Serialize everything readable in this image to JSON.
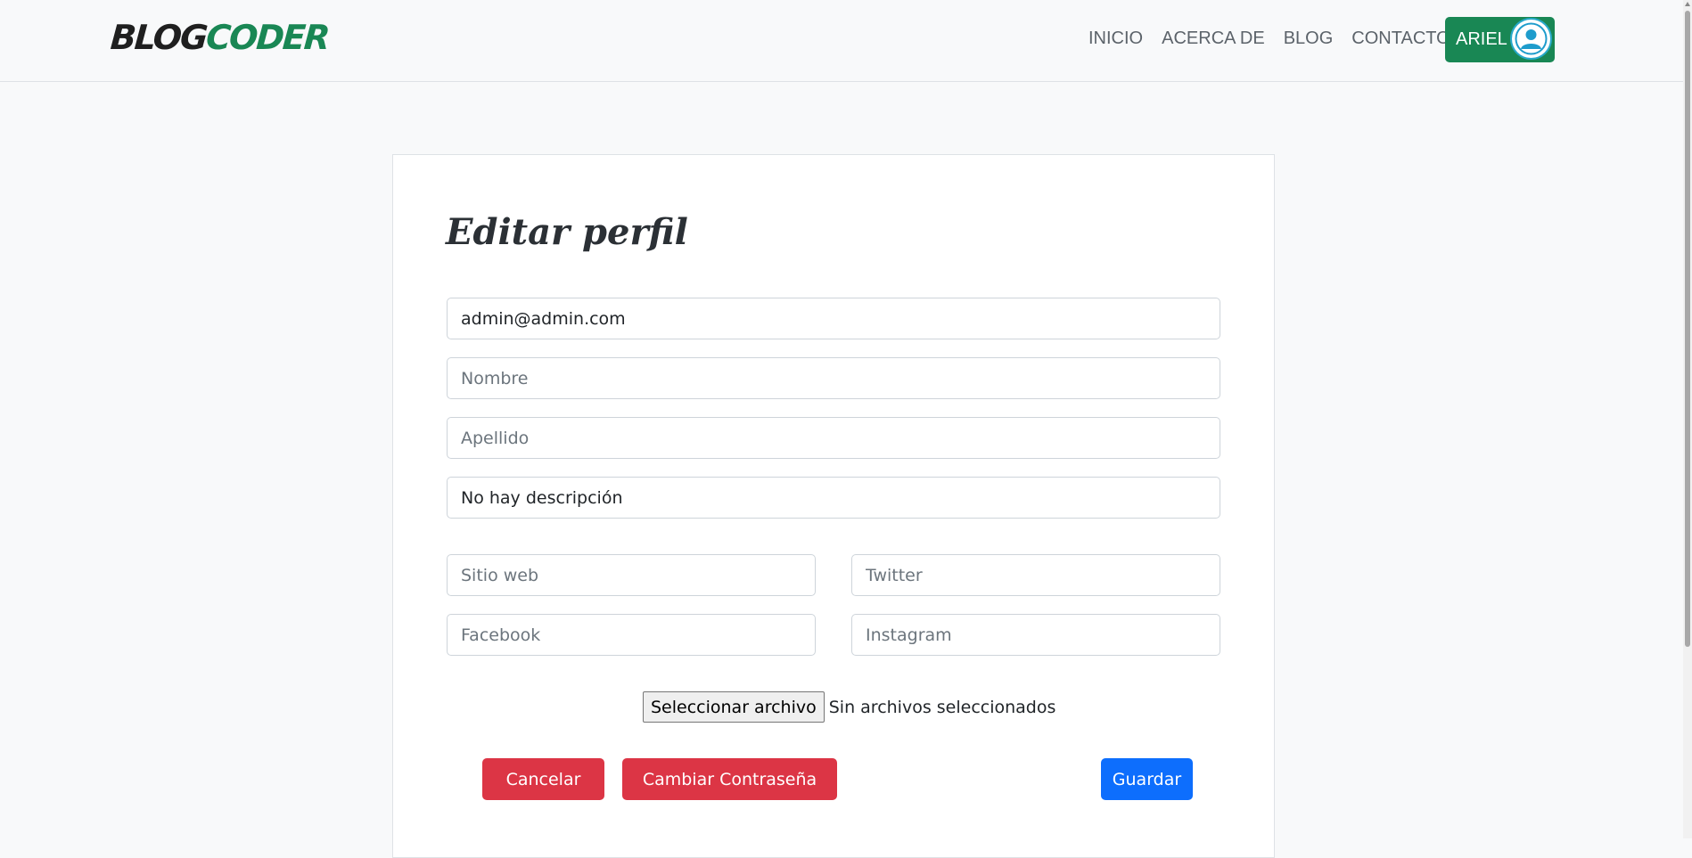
{
  "brand": {
    "part1": "BLOG",
    "part2": "CODER"
  },
  "nav": {
    "links": [
      "INICIO",
      "ACERCA DE",
      "BLOG",
      "CONTACTO"
    ],
    "user_label": "ARIEL"
  },
  "form": {
    "title": "Editar perfil",
    "email_value": "admin@admin.com",
    "nombre_placeholder": "Nombre",
    "apellido_placeholder": "Apellido",
    "descripcion_value": "No hay descripción",
    "sitio_web_placeholder": "Sitio web",
    "twitter_placeholder": "Twitter",
    "facebook_placeholder": "Facebook",
    "instagram_placeholder": "Instagram",
    "file_button_label": "Seleccionar archivo",
    "file_status": "Sin archivos seleccionados",
    "cancel_label": "Cancelar",
    "change_password_label": "Cambiar Contraseña",
    "save_label": "Guardar"
  },
  "colors": {
    "brand_green": "#198754",
    "danger": "#dc3545",
    "primary": "#0d6efd"
  }
}
